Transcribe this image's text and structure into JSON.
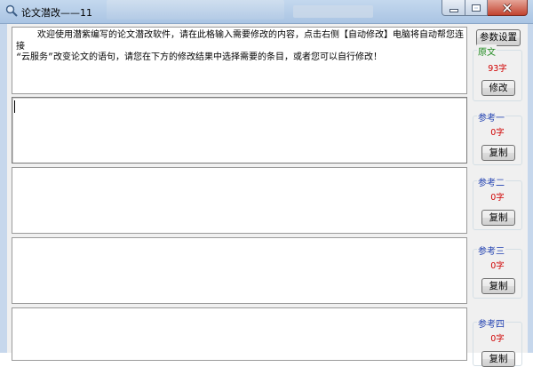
{
  "window": {
    "title": "论文潜改——11",
    "controls": {
      "minimize": "minimize-icon",
      "maximize": "maximize-icon",
      "close": "close-icon"
    }
  },
  "editor": {
    "intro_text": "    欢迎使用潜紫编写的论文潜改软件，请在此格输入需要修改的内容，点击右侧【自动修改】电脑将自动帮您连接\n“云服务”改变论文的语句，请您在下方的修改结果中选择需要的条目，或者您可以自行修改！"
  },
  "sidebar": {
    "settings_button": "参数设置",
    "groups": [
      {
        "label": "原文",
        "label_color": "#1f8a1f",
        "count": "93字",
        "button": "修改"
      },
      {
        "label": "参考一",
        "label_color": "#1f3fb0",
        "count": "0字",
        "button": "复制"
      },
      {
        "label": "参考二",
        "label_color": "#1f3fb0",
        "count": "0字",
        "button": "复制"
      },
      {
        "label": "参考三",
        "label_color": "#1f3fb0",
        "count": "0字",
        "button": "复制"
      },
      {
        "label": "参考四",
        "label_color": "#1f3fb0",
        "count": "0字",
        "button": "复制"
      }
    ]
  }
}
